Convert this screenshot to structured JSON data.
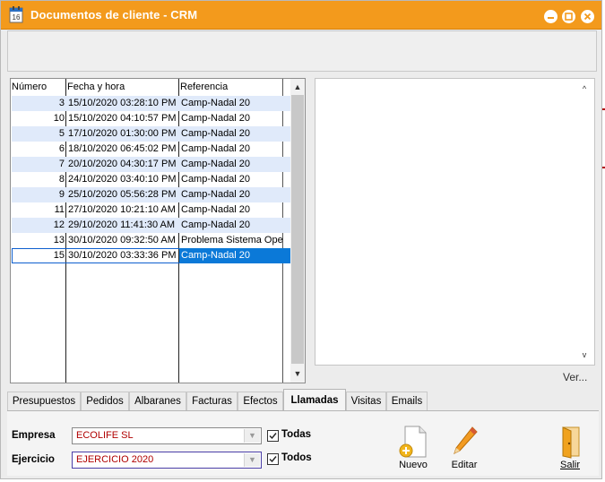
{
  "window": {
    "title": "Documentos de cliente - CRM",
    "title_bar_color": "#f39a1c"
  },
  "grid": {
    "columns": [
      "Número",
      "Fecha y hora",
      "Referencia"
    ],
    "rows": [
      {
        "numero": "3",
        "fecha": "15/10/2020 03:28:10 PM",
        "referencia": "Camp-Nadal 20"
      },
      {
        "numero": "10",
        "fecha": "15/10/2020 04:10:57 PM",
        "referencia": "Camp-Nadal 20"
      },
      {
        "numero": "5",
        "fecha": "17/10/2020 01:30:00 PM",
        "referencia": "Camp-Nadal 20"
      },
      {
        "numero": "6",
        "fecha": "18/10/2020 06:45:02 PM",
        "referencia": "Camp-Nadal 20"
      },
      {
        "numero": "7",
        "fecha": "20/10/2020 04:30:17 PM",
        "referencia": "Camp-Nadal 20"
      },
      {
        "numero": "8",
        "fecha": "24/10/2020 03:40:10 PM",
        "referencia": "Camp-Nadal 20"
      },
      {
        "numero": "9",
        "fecha": "25/10/2020 05:56:28 PM",
        "referencia": "Camp-Nadal 20"
      },
      {
        "numero": "11",
        "fecha": "27/10/2020 10:21:10 AM",
        "referencia": "Camp-Nadal 20"
      },
      {
        "numero": "12",
        "fecha": "29/10/2020 11:41:30 AM",
        "referencia": "Camp-Nadal 20"
      },
      {
        "numero": "13",
        "fecha": "30/10/2020 09:32:50 AM",
        "referencia": "Problema Sistema Ope"
      },
      {
        "numero": "15",
        "fecha": "30/10/2020 03:33:36 PM",
        "referencia": "Camp-Nadal 20"
      }
    ],
    "selected_row": 10
  },
  "memo": {
    "ver_link": "Ver..."
  },
  "tabs": [
    {
      "label": "Presupuestos"
    },
    {
      "label": "Pedidos"
    },
    {
      "label": "Albaranes"
    },
    {
      "label": "Facturas"
    },
    {
      "label": "Efectos"
    },
    {
      "label": "Llamadas",
      "active": true
    },
    {
      "label": "Visitas"
    },
    {
      "label": "Emails"
    }
  ],
  "filters": {
    "empresa_label": "Empresa",
    "empresa_value": "ECOLIFE SL",
    "todas_label": "Todas",
    "todas_checked": true,
    "ejercicio_label": "Ejercicio",
    "ejercicio_value": "EJERCICIO 2020",
    "todos_label": "Todos",
    "todos_checked": true
  },
  "actions": {
    "nuevo": "Nuevo",
    "editar": "Editar",
    "salir": "Salir"
  }
}
